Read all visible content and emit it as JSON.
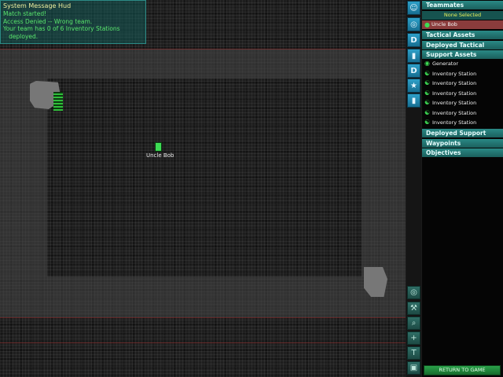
{
  "hud": {
    "title": "System Message Hud",
    "lines": [
      "Match started!",
      "Access Denied -- Wrong team.",
      "Your team has 0 of 6 Inventory Stations",
      "   deployed."
    ]
  },
  "map": {
    "player_name": "Uncle Bob"
  },
  "toolbar": {
    "top_buttons": [
      {
        "icon": "person-icon",
        "glyph": "☺"
      },
      {
        "icon": "target-icon",
        "glyph": "◎"
      },
      {
        "icon": "deploy-d-icon",
        "glyph": "D"
      },
      {
        "icon": "device-icon",
        "glyph": "▮"
      },
      {
        "icon": "deploy-d-icon",
        "glyph": "D"
      },
      {
        "icon": "runner-icon",
        "glyph": "★"
      },
      {
        "icon": "device-icon",
        "glyph": "▮"
      }
    ],
    "bottom_buttons": [
      {
        "icon": "center-icon",
        "glyph": "◎"
      },
      {
        "icon": "tools-icon",
        "glyph": "⚒"
      },
      {
        "icon": "zoom-icon",
        "glyph": "⌕"
      },
      {
        "icon": "crosshair-icon",
        "glyph": "+"
      },
      {
        "icon": "text-icon",
        "glyph": "T"
      },
      {
        "icon": "camera-icon",
        "glyph": "▣"
      }
    ]
  },
  "panel": {
    "teammates": "Teammates",
    "none_selected": "None Selected",
    "selected_player": "Uncle Bob",
    "tactical_assets": "Tactical Assets",
    "deployed_tactical": "Deployed Tactical",
    "support_assets": "Support Assets",
    "support_items": [
      "Generator",
      "Inventory Station",
      "Inventory Station",
      "Inventory Station",
      "Inventory Station",
      "Inventory Station",
      "Inventory Station"
    ],
    "deployed_support": "Deployed Support",
    "waypoints": "Waypoints",
    "objectives": "Objectives",
    "return_label": "RETURN TO GAME"
  },
  "colors": {
    "accent": "#2a8a86",
    "hud_text": "#59e66d",
    "selected": "#8a3c3c",
    "button": "#2ba24a"
  }
}
